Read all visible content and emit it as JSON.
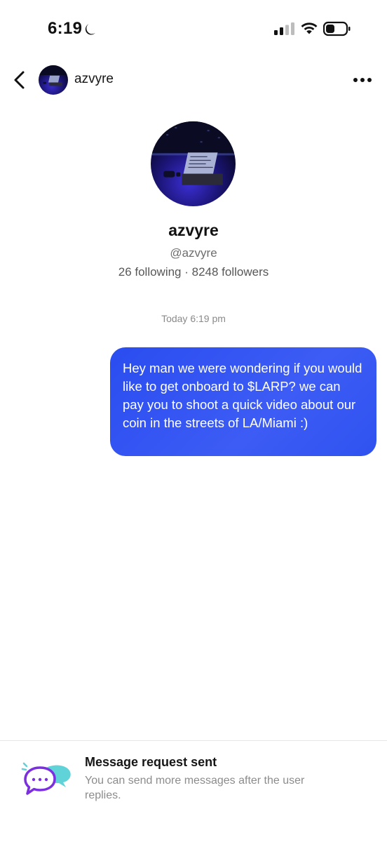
{
  "status_bar": {
    "time": "6:19",
    "icons": [
      "moon-icon",
      "cellular-signal-icon",
      "wifi-icon",
      "battery-icon"
    ]
  },
  "header": {
    "username": "azvyre",
    "icons": [
      "chevron-left-icon",
      "more-horizontal-icon"
    ]
  },
  "profile": {
    "display_name": "azvyre",
    "handle": "@azvyre",
    "stats": "26 following · 8248 followers"
  },
  "conversation": {
    "timestamp": "Today 6:19 pm",
    "messages": [
      {
        "direction": "outgoing",
        "text": "Hey man we were wondering if you would like to get onboard to $LARP? we can pay you to shoot a quick video about our coin in the streets of LA/Miami :)"
      }
    ]
  },
  "footer": {
    "title": "Message request sent",
    "description": "You can send more messages after the user replies.",
    "icon": "message-bubbles-icon"
  },
  "colors": {
    "bubble": "#3153f2",
    "bubble_text": "#ffffff",
    "footer_icon_purple": "#7b2fe0",
    "footer_icon_teal": "#5fd3d8"
  }
}
